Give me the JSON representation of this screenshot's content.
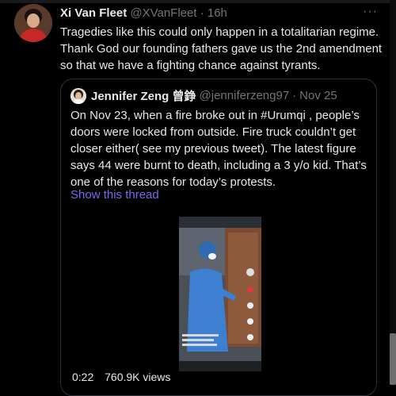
{
  "tweet": {
    "author_name": "Xi Van Fleet",
    "author_handle": "@XVanFleet",
    "time": "16h",
    "separator": "·",
    "more_icon": "more-horizontal-icon",
    "text": "Tragedies like this could only happen in a totalitarian regime. Thank God our founding fathers gave us the 2nd amendment so that we have a fighting chance against tyrants."
  },
  "quote": {
    "author_name": "Jennifer Zeng 曾錚",
    "author_handle": "@jenniferzeng97",
    "time": "Nov 25",
    "separator": "·",
    "text": "On Nov 23, when a fire broke out in #Urumqi , people’s doors were locked from outside. Fire truck couldn’t get closer either( see my previous tweet). The latest figure says 44 were burnt to death, including a 3 y/o kid. That’s one of the reasons for today’s protests.",
    "show_thread": "Show this thread",
    "media": {
      "duration": "0:22",
      "views": "760.9K views"
    }
  },
  "colors": {
    "background": "#000000",
    "text": "#e7e9ea",
    "muted": "#71767b",
    "link": "#7b68ee",
    "border": "#2f3336"
  }
}
